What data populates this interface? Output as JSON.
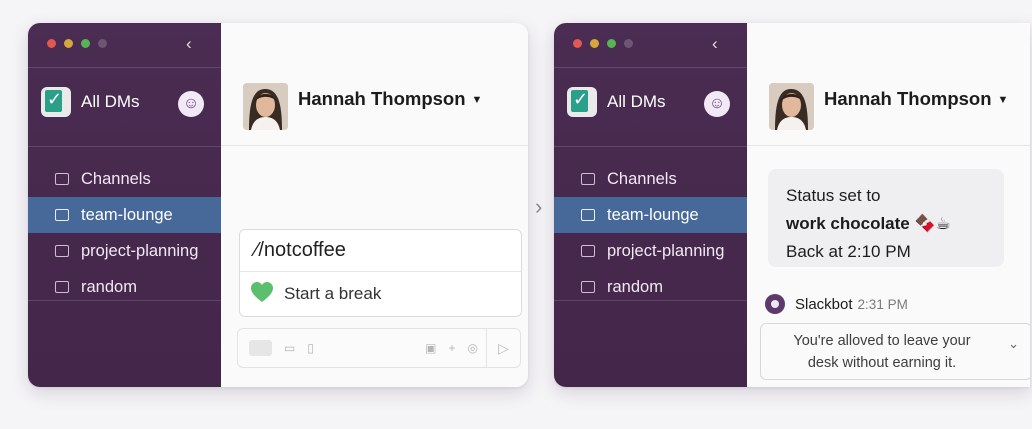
{
  "sidebar": {
    "workspace_title": "All DMs",
    "back_icon": "‹",
    "items": [
      {
        "label": "Channels",
        "icon": "✉"
      },
      {
        "label": "team-lounge",
        "icon": "▚",
        "active": true
      },
      {
        "label": "project-planning",
        "icon": "☰"
      },
      {
        "label": "random",
        "icon": "☺"
      }
    ]
  },
  "header": {
    "name": "Hannah Thompson",
    "caret": "▼"
  },
  "left_panel": {
    "command_text": "⁄/notcoffee",
    "suggestion_label": "Start a break",
    "suggestion_icon": "green-heart-icon",
    "send_icon": "▷"
  },
  "between_chevron": "›",
  "right_panel": {
    "status_line1": "Status set to",
    "status_line2": "work chocolate 🍫☕",
    "status_line3": "Back at 2:10 PM",
    "bot_name": "Slackbot",
    "bot_time": "2:31 PM",
    "bot_message_line1": "You're alloved to leave your",
    "bot_message_line2": "desk without earning it.",
    "bot_chevron": "⌄"
  },
  "colors": {
    "sidebar": "#4b2c52",
    "active_item": "#46699a",
    "accent_green": "#5bbf6e"
  }
}
